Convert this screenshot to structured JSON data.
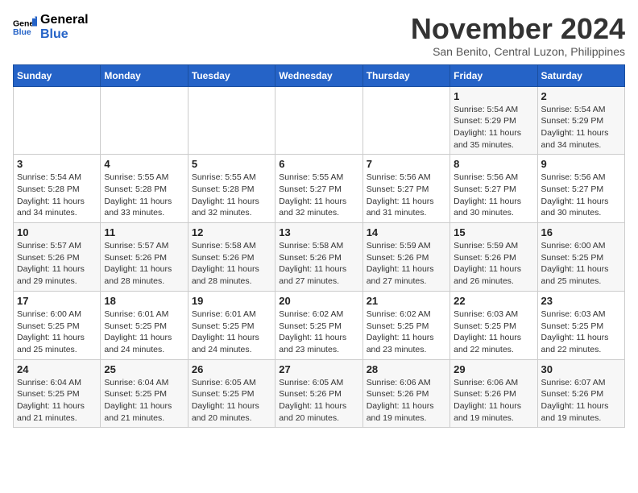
{
  "logo": {
    "line1": "General",
    "line2": "Blue"
  },
  "title": "November 2024",
  "subtitle": "San Benito, Central Luzon, Philippines",
  "weekdays": [
    "Sunday",
    "Monday",
    "Tuesday",
    "Wednesday",
    "Thursday",
    "Friday",
    "Saturday"
  ],
  "weeks": [
    [
      {
        "day": "",
        "info": ""
      },
      {
        "day": "",
        "info": ""
      },
      {
        "day": "",
        "info": ""
      },
      {
        "day": "",
        "info": ""
      },
      {
        "day": "",
        "info": ""
      },
      {
        "day": "1",
        "info": "Sunrise: 5:54 AM\nSunset: 5:29 PM\nDaylight: 11 hours and 35 minutes."
      },
      {
        "day": "2",
        "info": "Sunrise: 5:54 AM\nSunset: 5:29 PM\nDaylight: 11 hours and 34 minutes."
      }
    ],
    [
      {
        "day": "3",
        "info": "Sunrise: 5:54 AM\nSunset: 5:28 PM\nDaylight: 11 hours and 34 minutes."
      },
      {
        "day": "4",
        "info": "Sunrise: 5:55 AM\nSunset: 5:28 PM\nDaylight: 11 hours and 33 minutes."
      },
      {
        "day": "5",
        "info": "Sunrise: 5:55 AM\nSunset: 5:28 PM\nDaylight: 11 hours and 32 minutes."
      },
      {
        "day": "6",
        "info": "Sunrise: 5:55 AM\nSunset: 5:27 PM\nDaylight: 11 hours and 32 minutes."
      },
      {
        "day": "7",
        "info": "Sunrise: 5:56 AM\nSunset: 5:27 PM\nDaylight: 11 hours and 31 minutes."
      },
      {
        "day": "8",
        "info": "Sunrise: 5:56 AM\nSunset: 5:27 PM\nDaylight: 11 hours and 30 minutes."
      },
      {
        "day": "9",
        "info": "Sunrise: 5:56 AM\nSunset: 5:27 PM\nDaylight: 11 hours and 30 minutes."
      }
    ],
    [
      {
        "day": "10",
        "info": "Sunrise: 5:57 AM\nSunset: 5:26 PM\nDaylight: 11 hours and 29 minutes."
      },
      {
        "day": "11",
        "info": "Sunrise: 5:57 AM\nSunset: 5:26 PM\nDaylight: 11 hours and 28 minutes."
      },
      {
        "day": "12",
        "info": "Sunrise: 5:58 AM\nSunset: 5:26 PM\nDaylight: 11 hours and 28 minutes."
      },
      {
        "day": "13",
        "info": "Sunrise: 5:58 AM\nSunset: 5:26 PM\nDaylight: 11 hours and 27 minutes."
      },
      {
        "day": "14",
        "info": "Sunrise: 5:59 AM\nSunset: 5:26 PM\nDaylight: 11 hours and 27 minutes."
      },
      {
        "day": "15",
        "info": "Sunrise: 5:59 AM\nSunset: 5:26 PM\nDaylight: 11 hours and 26 minutes."
      },
      {
        "day": "16",
        "info": "Sunrise: 6:00 AM\nSunset: 5:25 PM\nDaylight: 11 hours and 25 minutes."
      }
    ],
    [
      {
        "day": "17",
        "info": "Sunrise: 6:00 AM\nSunset: 5:25 PM\nDaylight: 11 hours and 25 minutes."
      },
      {
        "day": "18",
        "info": "Sunrise: 6:01 AM\nSunset: 5:25 PM\nDaylight: 11 hours and 24 minutes."
      },
      {
        "day": "19",
        "info": "Sunrise: 6:01 AM\nSunset: 5:25 PM\nDaylight: 11 hours and 24 minutes."
      },
      {
        "day": "20",
        "info": "Sunrise: 6:02 AM\nSunset: 5:25 PM\nDaylight: 11 hours and 23 minutes."
      },
      {
        "day": "21",
        "info": "Sunrise: 6:02 AM\nSunset: 5:25 PM\nDaylight: 11 hours and 23 minutes."
      },
      {
        "day": "22",
        "info": "Sunrise: 6:03 AM\nSunset: 5:25 PM\nDaylight: 11 hours and 22 minutes."
      },
      {
        "day": "23",
        "info": "Sunrise: 6:03 AM\nSunset: 5:25 PM\nDaylight: 11 hours and 22 minutes."
      }
    ],
    [
      {
        "day": "24",
        "info": "Sunrise: 6:04 AM\nSunset: 5:25 PM\nDaylight: 11 hours and 21 minutes."
      },
      {
        "day": "25",
        "info": "Sunrise: 6:04 AM\nSunset: 5:25 PM\nDaylight: 11 hours and 21 minutes."
      },
      {
        "day": "26",
        "info": "Sunrise: 6:05 AM\nSunset: 5:25 PM\nDaylight: 11 hours and 20 minutes."
      },
      {
        "day": "27",
        "info": "Sunrise: 6:05 AM\nSunset: 5:26 PM\nDaylight: 11 hours and 20 minutes."
      },
      {
        "day": "28",
        "info": "Sunrise: 6:06 AM\nSunset: 5:26 PM\nDaylight: 11 hours and 19 minutes."
      },
      {
        "day": "29",
        "info": "Sunrise: 6:06 AM\nSunset: 5:26 PM\nDaylight: 11 hours and 19 minutes."
      },
      {
        "day": "30",
        "info": "Sunrise: 6:07 AM\nSunset: 5:26 PM\nDaylight: 11 hours and 19 minutes."
      }
    ]
  ]
}
